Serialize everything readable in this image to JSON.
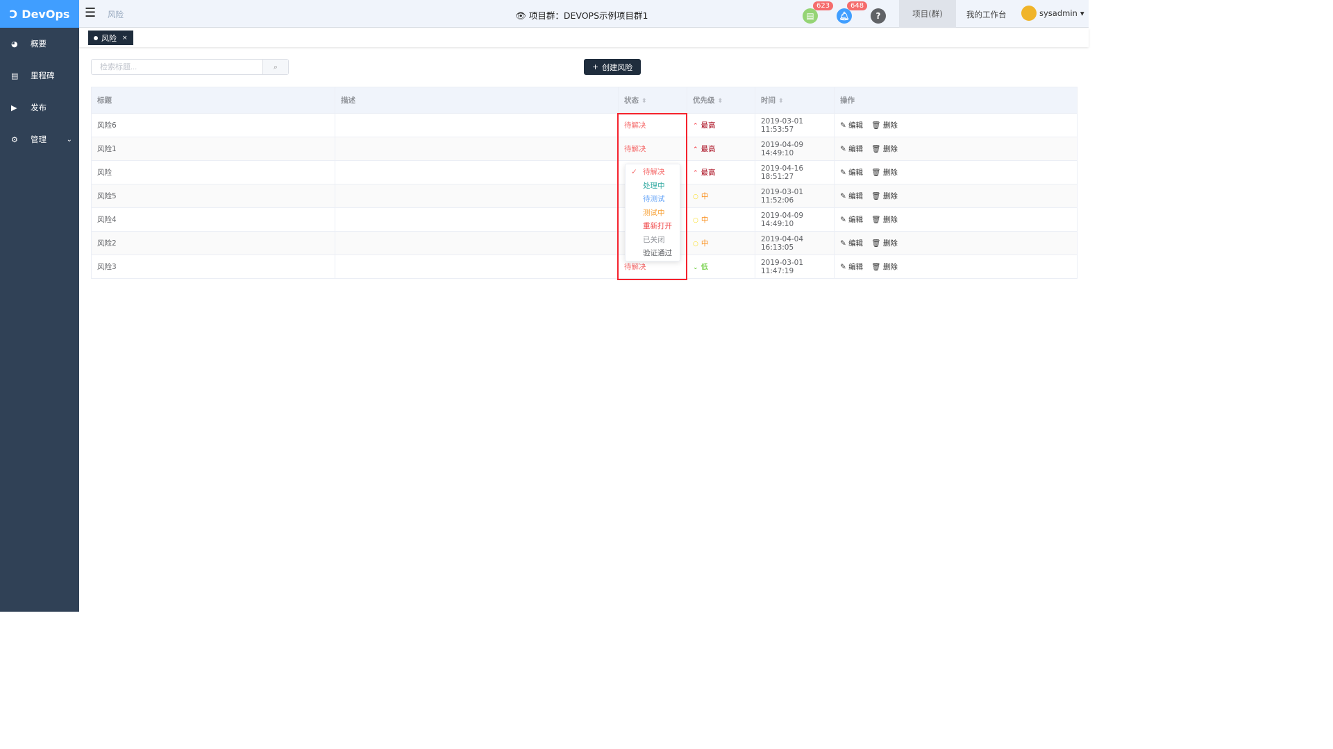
{
  "app": {
    "name": "DevOps"
  },
  "sidebar": {
    "items": [
      {
        "label": "概要",
        "icon": "dashboard-icon"
      },
      {
        "label": "里程碑",
        "icon": "milestone-icon"
      },
      {
        "label": "发布",
        "icon": "release-icon"
      },
      {
        "label": "管理",
        "icon": "gear-icon"
      }
    ]
  },
  "header": {
    "breadcrumb": "风险",
    "title": "项目群：DEVOPS示例项目群1",
    "doc_badge": "623",
    "bell_badge": "648",
    "project_tab": "项目(群)",
    "workbench": "我的工作台",
    "user": "sysadmin"
  },
  "tabs": [
    {
      "label": "风险",
      "close": "×"
    }
  ],
  "toolbar": {
    "search_placeholder": "检索标题...",
    "create_label": "创建风险"
  },
  "table": {
    "columns": [
      "标题",
      "描述",
      "状态",
      "优先级",
      "时间",
      "操作"
    ],
    "rows": [
      {
        "title": "风险6",
        "desc": "",
        "status": "待解决",
        "priority": "最高",
        "time": "2019-03-01 11:53:57"
      },
      {
        "title": "风险1",
        "desc": "",
        "status": "待解决",
        "priority": "最高",
        "time": "2019-04-09 14:49:10"
      },
      {
        "title": "风险",
        "desc": "",
        "status": "",
        "priority": "最高",
        "time": "2019-04-16 18:51:27"
      },
      {
        "title": "风险5",
        "desc": "",
        "status": "",
        "priority": "中",
        "time": "2019-03-01 11:52:06"
      },
      {
        "title": "风险4",
        "desc": "",
        "status": "",
        "priority": "中",
        "time": "2019-04-09 14:49:10"
      },
      {
        "title": "风险2",
        "desc": "",
        "status": "",
        "priority": "中",
        "time": "2019-04-04 16:13:05"
      },
      {
        "title": "风险3",
        "desc": "",
        "status": "待解决",
        "priority": "低",
        "time": "2019-03-01 11:47:19"
      }
    ],
    "edit": "编辑",
    "delete": "删除"
  },
  "status_dropdown": {
    "selected": "待解决",
    "options": [
      {
        "label": "待解决",
        "color": "#f56c6c"
      },
      {
        "label": "处理中",
        "color": "#2fa8a0"
      },
      {
        "label": "待测试",
        "color": "#6aa7f8"
      },
      {
        "label": "测试中",
        "color": "#f7a035"
      },
      {
        "label": "重新打开",
        "color": "#f0494b"
      },
      {
        "label": "已关闭",
        "color": "#909399"
      },
      {
        "label": "验证通过",
        "color": "#606266"
      }
    ]
  },
  "priority_colors": {
    "最高": "#a8071a",
    "中": "#fa8c16",
    "低": "#52c41a"
  }
}
